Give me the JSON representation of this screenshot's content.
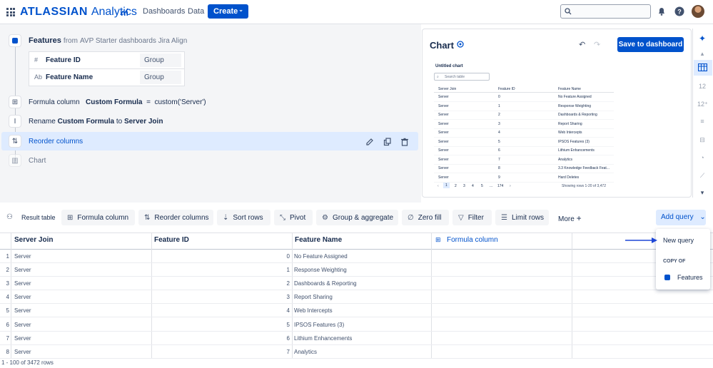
{
  "nav": {
    "brand_bold": "ATLASSIAN",
    "brand_light": "Analytics",
    "links": [
      "Dashboards",
      "Data"
    ],
    "create_label": "Create"
  },
  "pipeline": {
    "source_title": "Features",
    "source_from": "from",
    "source_path": "AVP Starter dashboards Jira Align",
    "columns": [
      {
        "icon": "#",
        "name": "Feature ID",
        "type": "Group"
      },
      {
        "icon": "Ab",
        "name": "Feature Name",
        "type": "Group"
      }
    ],
    "formula": {
      "prefix": "Formula column",
      "name": "Custom Formula",
      "eq": "=",
      "expr": "custom('Server')"
    },
    "rename": {
      "prefix": "Rename",
      "from": "Custom Formula",
      "to_word": "to",
      "to": "Server Join"
    },
    "reorder_label": "Reorder columns",
    "chart_label": "Chart"
  },
  "chart_panel": {
    "title": "Chart",
    "save_label": "Save to dashboard",
    "mini_title": "Untitled chart",
    "mini_search": "Search table",
    "mini_headers": [
      "Server Join",
      "Feature ID",
      "Feature Name"
    ],
    "mini_rows": [
      [
        "Server",
        "0",
        "No Feature Assigned"
      ],
      [
        "Server",
        "1",
        "Response Weighting"
      ],
      [
        "Server",
        "2",
        "Dashboards & Reporting"
      ],
      [
        "Server",
        "3",
        "Report Sharing"
      ],
      [
        "Server",
        "4",
        "Web Intercepts"
      ],
      [
        "Server",
        "5",
        "IPSOS Features (3)"
      ],
      [
        "Server",
        "6",
        "Lithium Enhancements"
      ],
      [
        "Server",
        "7",
        "Analytics"
      ],
      [
        "Server",
        "8",
        "3.3 Knowledge Feedback Feat..."
      ],
      [
        "Server",
        "9",
        "Hard Deletes"
      ]
    ],
    "pager": [
      "1",
      "2",
      "3",
      "4",
      "5",
      "...",
      "174"
    ],
    "rows_info": "Showing rows 1-20 of 3,472"
  },
  "toolbar": {
    "result_table": "Result table",
    "buttons": [
      "Formula column",
      "Reorder columns",
      "Sort rows",
      "Pivot",
      "Group & aggregate",
      "Zero fill",
      "Filter",
      "Limit rows"
    ],
    "more": "More",
    "add_query": "Add query"
  },
  "dropdown": {
    "new_query": "New query",
    "copy_of": "COPY OF",
    "features": "Features"
  },
  "table": {
    "headers": [
      "Server Join",
      "Feature ID",
      "Feature Name",
      "Formula column"
    ],
    "rows": [
      [
        "1",
        "Server",
        "0",
        "No Feature Assigned"
      ],
      [
        "2",
        "Server",
        "1",
        "Response Weighting"
      ],
      [
        "3",
        "Server",
        "2",
        "Dashboards & Reporting"
      ],
      [
        "4",
        "Server",
        "3",
        "Report Sharing"
      ],
      [
        "5",
        "Server",
        "4",
        "Web Intercepts"
      ],
      [
        "6",
        "Server",
        "5",
        "IPSOS Features (3)"
      ],
      [
        "7",
        "Server",
        "6",
        "Lithium Enhancements"
      ],
      [
        "8",
        "Server",
        "7",
        "Analytics"
      ]
    ],
    "footer": "1 - 100 of 3472 rows"
  }
}
